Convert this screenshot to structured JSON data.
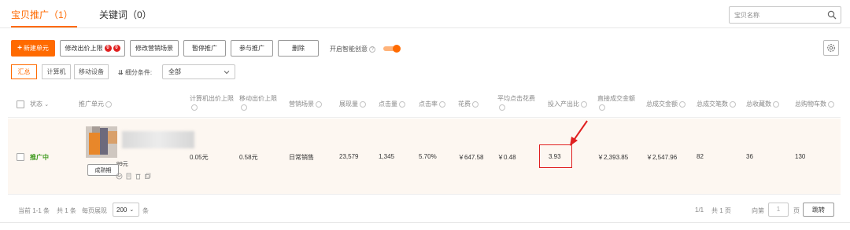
{
  "tabs": [
    {
      "label": "宝贝推广（1）"
    },
    {
      "label": "关键词（0）"
    }
  ],
  "search": {
    "placeholder": "宝贝名称"
  },
  "toolbar": {
    "new_unit": "新建单元",
    "modify_bid_limit": "修改出价上限",
    "modify_bid_badges": [
      "0",
      "0"
    ],
    "modify_scene": "修改营销场景",
    "pause": "暂停推广",
    "join": "参与推广",
    "delete": "删除",
    "smart_creative_label": "开启智能创意"
  },
  "device_tabs": [
    "汇总",
    "计算机",
    "移动设备"
  ],
  "filter": {
    "label": "细分条件:",
    "selected": "全部"
  },
  "columns": [
    "状态",
    "推广单元",
    "计算机出价上限",
    "移动出价上限",
    "营销场景",
    "展现量",
    "点击量",
    "点击率",
    "花费",
    "平均点击花费",
    "投入产出比",
    "直接成交金额",
    "总成交金额",
    "总成交笔数",
    "总收藏数",
    "总购物车数"
  ],
  "row": {
    "status": "推广中",
    "price": "99元",
    "mature_btn": "成熟期",
    "pc_bid": "0.05元",
    "mobile_bid": "0.58元",
    "scene": "日常销售",
    "impressions": "23,579",
    "clicks": "1,345",
    "ctr": "5.70%",
    "cost": "￥647.58",
    "avg_cpc": "￥0.48",
    "roi": "3.93",
    "direct_gmv": "￥2,393.85",
    "total_gmv": "￥2,547.96",
    "total_orders": "82",
    "total_favorites": "36",
    "total_cart": "130"
  },
  "pagination": {
    "current": "当前 1-1 条",
    "total": "共 1 条",
    "per_page_label": "每页展现",
    "per_page_value": "200",
    "per_page_unit": "条",
    "page_info": "1/1",
    "total_pages": "共 1 页",
    "goto_label": "向第",
    "goto_value": "1",
    "page_unit": "页",
    "jump": "跳转"
  },
  "colors": {
    "accent": "#ff6a00",
    "success": "#3f9a1f",
    "alert": "#e02020",
    "row_highlight": "#fdf7f1"
  },
  "icons": [
    "search-icon",
    "plus-icon",
    "help-icon",
    "toggle-switch",
    "gear-icon",
    "chevron-down-icon",
    "sort-icon",
    "arrow-annotation"
  ]
}
